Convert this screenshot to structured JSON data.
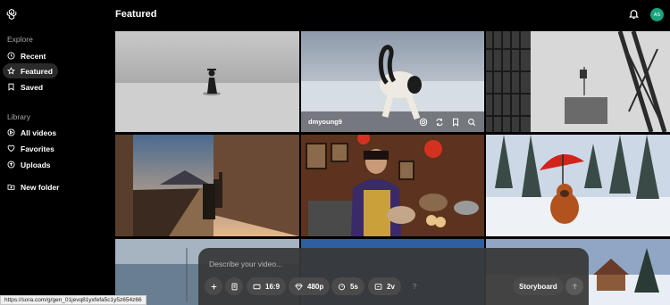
{
  "header": {
    "title": "Featured"
  },
  "user": {
    "initials": "AS",
    "avatar_color": "#19a37e"
  },
  "sidebar": {
    "explore_label": "Explore",
    "library_label": "Library",
    "items": [
      {
        "label": "Recent",
        "icon": "clock-icon"
      },
      {
        "label": "Featured",
        "icon": "star-icon",
        "active": true
      },
      {
        "label": "Saved",
        "icon": "bookmark-icon"
      },
      {
        "label": "All videos",
        "icon": "grid-icon"
      },
      {
        "label": "Favorites",
        "icon": "heart-icon"
      },
      {
        "label": "Uploads",
        "icon": "upload-icon"
      },
      {
        "label": "New folder",
        "icon": "folder-plus-icon"
      }
    ]
  },
  "grid": {
    "hover_tile": {
      "username": "dmyoung9",
      "actions": [
        "loop-icon",
        "remix-icon",
        "bookmark-icon",
        "search-icon"
      ]
    }
  },
  "prompt": {
    "placeholder": "Describe your video...",
    "aspect_ratio": "16:9",
    "resolution": "480p",
    "duration": "5s",
    "variations": "2v",
    "help": "?",
    "storyboard_label": "Storyboard"
  },
  "status_bar": {
    "url": "https://sora.com/g/gen_01jevq81yxfefa5c1y5z654z66"
  }
}
